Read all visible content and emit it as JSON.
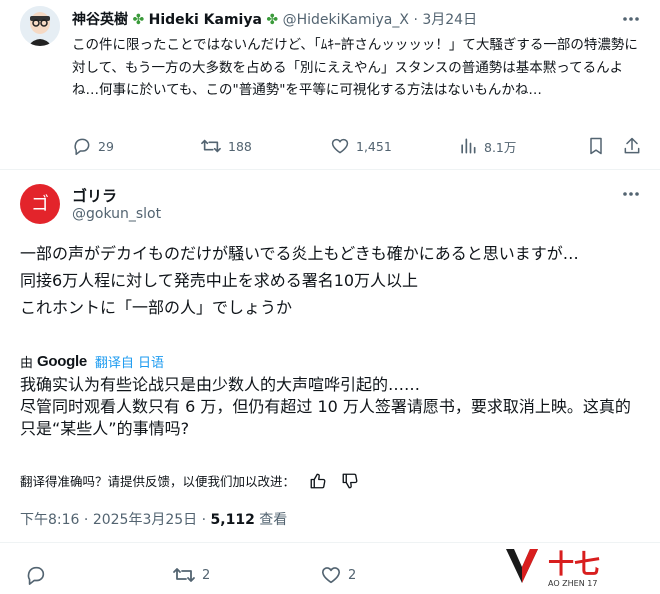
{
  "quoted": {
    "name": "神谷英樹",
    "name_en": "Hideki Kamiya",
    "clover": "✤",
    "handle": "@HidekiKamiya_X",
    "dot": "·",
    "date": "3月24日",
    "text": "この件に限ったことではないんだけど、「ﾑｷｰ許さんッッッッ！」て大騒ぎする一部の特濃勢に対して、もう一方の大多数を占める「別にええやん」スタンスの普通勢は基本黙ってるんよね…何事に於いても、この\"普通勢\"を平等に可視化する方法はないもんかね…",
    "stats": {
      "replies": "29",
      "reposts": "188",
      "likes": "1,451",
      "views": "8.1万"
    }
  },
  "tweet": {
    "name": "ゴリラ",
    "handle": "@gokun_slot",
    "avatar_char": "ゴ",
    "lines": [
      "一部の声がデカイものだけが騒いでる炎上もどきも確かにあると思いますが…",
      "同接6万人程に対して発売中止を求める署名10万人以上",
      "これホントに「一部の人」でしょうか"
    ],
    "translated_by": "由",
    "google": "Google",
    "translated_from": "翻译自 日语",
    "translation": [
      "我确实认为有些论战只是由少数人的大声喧哗引起的……",
      "尽管同时观看人数只有 6 万，但仍有超过 10 万人签署请愿书，要求取消上映。这真的只是“某些人”的事情吗?"
    ],
    "feedback": "翻译得准确吗？请提供反馈，以便我们加以改进：",
    "time": "下午8:16",
    "sep": "·",
    "date": "2025年3月25日",
    "views_count": "5,112",
    "views_label": "查看",
    "stats": {
      "reposts": "2",
      "likes": "2"
    }
  },
  "watermark": {
    "brand": "十七",
    "sub": "AO ZHEN 17"
  },
  "colors": {
    "accent": "#1d9bf0",
    "muted": "#536471",
    "avatar_red": "#e3242b"
  }
}
